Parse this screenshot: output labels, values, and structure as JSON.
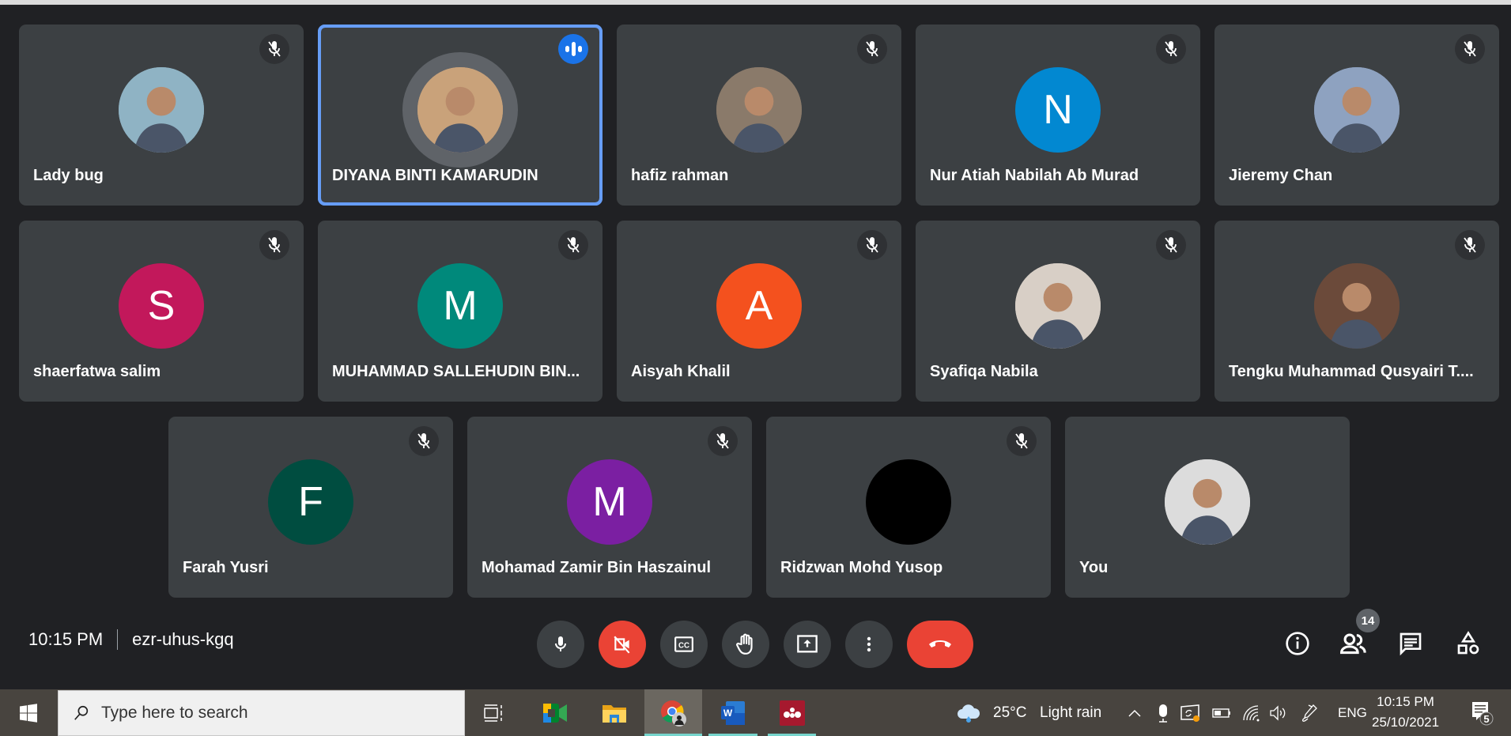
{
  "meeting": {
    "time": "10:15 PM",
    "code": "ezr-uhus-kgq",
    "participant_count": "14"
  },
  "participants": [
    {
      "name": "Lady bug",
      "avatar_type": "photo",
      "avatar_color": "#8fb3c4",
      "muted": true,
      "speaking": false
    },
    {
      "name": "DIYANA BINTI KAMARUDIN",
      "avatar_type": "photo",
      "avatar_color": "#c9a27a",
      "muted": false,
      "speaking": true
    },
    {
      "name": "hafiz rahman",
      "avatar_type": "photo",
      "avatar_color": "#8a7a6a",
      "muted": true,
      "speaking": false
    },
    {
      "name": "Nur Atiah Nabilah Ab Murad",
      "avatar_type": "initial",
      "initial": "N",
      "avatar_color": "#0288d1",
      "muted": true,
      "speaking": false
    },
    {
      "name": "Jieremy Chan",
      "avatar_type": "photo",
      "avatar_color": "#8ea2c0",
      "muted": true,
      "speaking": false
    },
    {
      "name": "shaerfatwa salim",
      "avatar_type": "initial",
      "initial": "S",
      "avatar_color": "#c2185b",
      "muted": true,
      "speaking": false
    },
    {
      "name": "MUHAMMAD SALLEHUDIN BIN...",
      "avatar_type": "initial",
      "initial": "M",
      "avatar_color": "#00897b",
      "muted": true,
      "speaking": false
    },
    {
      "name": "Aisyah Khalil",
      "avatar_type": "initial",
      "initial": "A",
      "avatar_color": "#f4511e",
      "muted": true,
      "speaking": false
    },
    {
      "name": "Syafiqa Nabila",
      "avatar_type": "photo",
      "avatar_color": "#d8cfc6",
      "muted": true,
      "speaking": false
    },
    {
      "name": "Tengku Muhammad Qusyairi T....",
      "avatar_type": "photo",
      "avatar_color": "#6b4a3a",
      "muted": true,
      "speaking": false
    },
    {
      "name": "Farah Yusri",
      "avatar_type": "initial",
      "initial": "F",
      "avatar_color": "#004d40",
      "muted": true,
      "speaking": false
    },
    {
      "name": "Mohamad Zamir Bin Haszainul",
      "avatar_type": "initial",
      "initial": "M",
      "avatar_color": "#7b1fa2",
      "muted": true,
      "speaking": false
    },
    {
      "name": "Ridzwan Mohd Yusop",
      "avatar_type": "blank",
      "avatar_color": "#000000",
      "muted": true,
      "speaking": false
    },
    {
      "name": "You",
      "avatar_type": "photo",
      "avatar_color": "#dcdcdc",
      "muted": false,
      "speaking": false
    }
  ],
  "controls": [
    {
      "name": "microphone-button",
      "icon": "mic-icon",
      "state": "on"
    },
    {
      "name": "camera-button",
      "icon": "camera-off-icon",
      "state": "off"
    },
    {
      "name": "captions-button",
      "icon": "cc-icon"
    },
    {
      "name": "raise-hand-button",
      "icon": "hand-icon"
    },
    {
      "name": "present-button",
      "icon": "present-icon"
    },
    {
      "name": "more-options-button",
      "icon": "more-vert-icon"
    },
    {
      "name": "leave-call-button",
      "icon": "hang-up-icon"
    }
  ],
  "side_controls": [
    {
      "name": "meeting-details-button",
      "icon": "info-icon"
    },
    {
      "name": "people-button",
      "icon": "people-icon"
    },
    {
      "name": "chat-button",
      "icon": "chat-icon"
    },
    {
      "name": "activities-button",
      "icon": "shapes-icon"
    }
  ],
  "taskbar": {
    "search_placeholder": "Type here to search",
    "weather_temp": "25°C",
    "weather_desc": "Light rain",
    "language": "ENG",
    "clock_time": "10:15 PM",
    "clock_date": "25/10/2021",
    "notification_count": "5",
    "apps": [
      "task-view",
      "google-meet",
      "file-explorer",
      "chrome",
      "word",
      "mendeley"
    ]
  }
}
